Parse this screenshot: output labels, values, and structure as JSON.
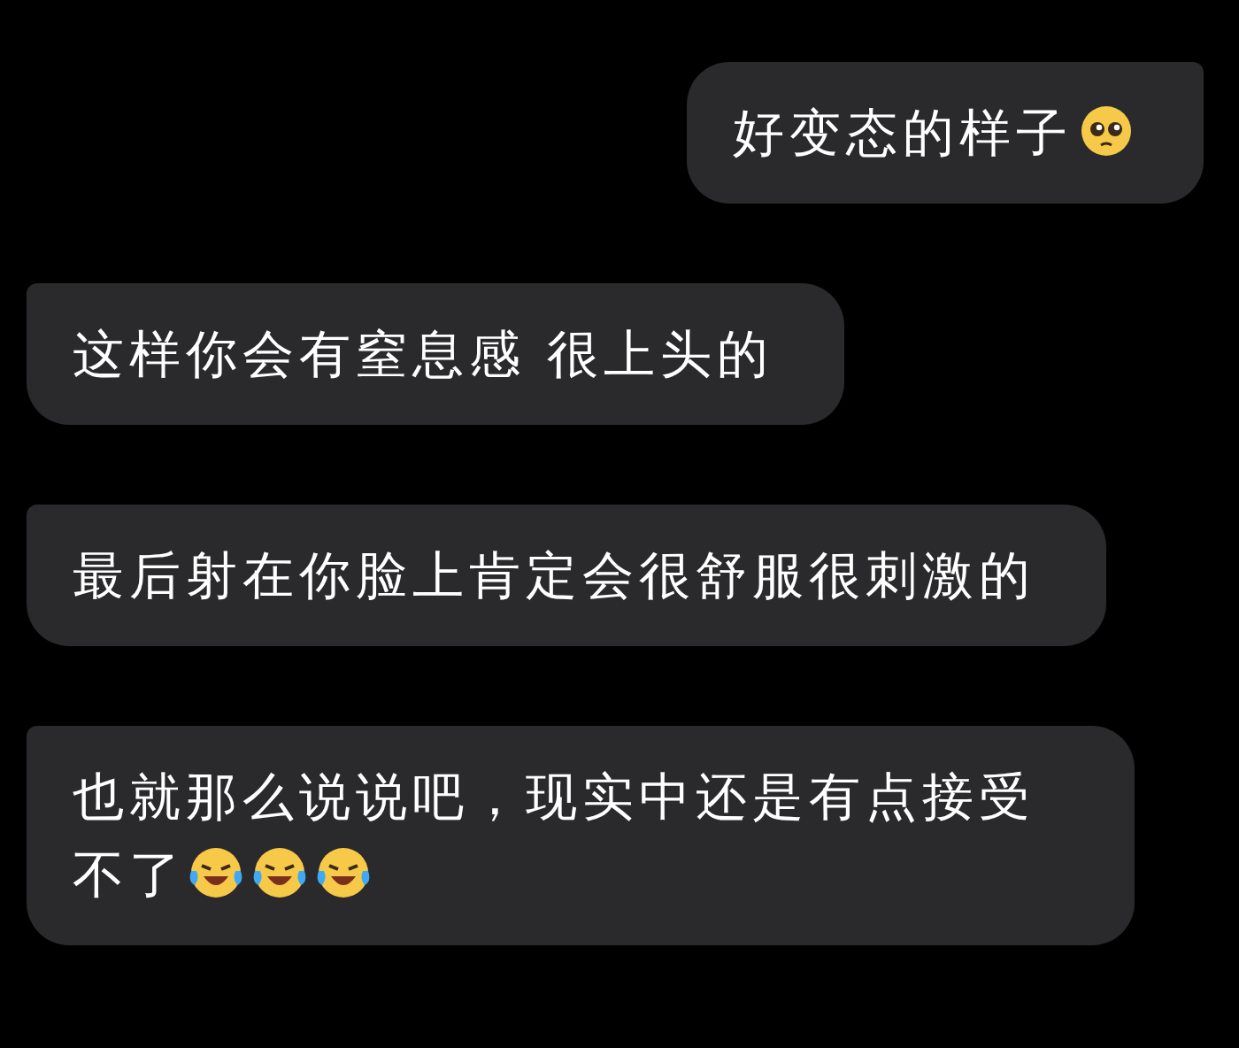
{
  "messages": [
    {
      "sent": true,
      "text": "好变态的样子",
      "emojis": [
        {
          "kind": "pleading"
        }
      ]
    },
    {
      "sent": false,
      "text": "这样你会有窒息感 很上头的"
    },
    {
      "sent": false,
      "text": "最后射在你脸上肯定会很舒服很刺激的"
    },
    {
      "sent": false,
      "text": "也就那么说说吧，现实中还是有点接受不了",
      "emojis": [
        {
          "kind": "tears_of_joy"
        },
        {
          "kind": "tears_of_joy"
        },
        {
          "kind": "tears_of_joy"
        }
      ]
    }
  ]
}
